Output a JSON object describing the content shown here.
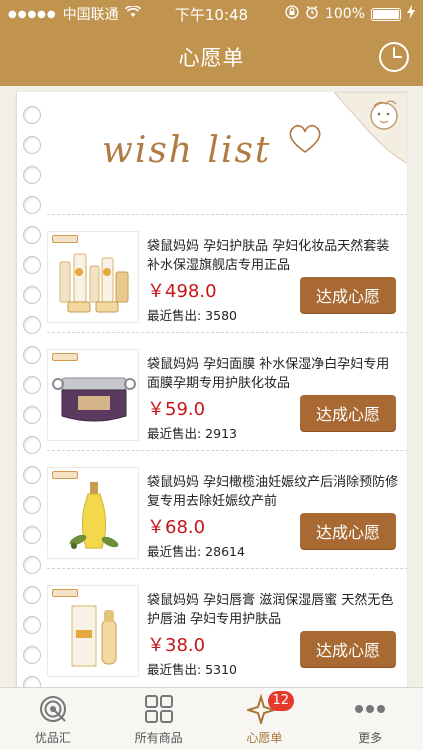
{
  "status_bar": {
    "signal": "●●●●●",
    "carrier": "中国联通",
    "time": "下午10:48",
    "battery": "100%"
  },
  "nav": {
    "title": "心愿单",
    "history_icon": "clock-icon"
  },
  "wishlist": {
    "header_text": "wish list",
    "items": [
      {
        "title": "袋鼠妈妈 孕妇护肤品 孕妇化妆品天然套装补水保湿旗舰店专用正品",
        "price": "￥498.0",
        "sold": "最近售出: 3580",
        "button": "达成心愿"
      },
      {
        "title": "袋鼠妈妈 孕妇面膜 补水保湿净白孕妇专用面膜孕期专用护肤化妆品",
        "price": "￥59.0",
        "sold": "最近售出: 2913",
        "button": "达成心愿"
      },
      {
        "title": "袋鼠妈妈 孕妇橄榄油妊娠纹产后消除预防修复专用去除妊娠纹产前",
        "price": "￥68.0",
        "sold": "最近售出: 28614",
        "button": "达成心愿"
      },
      {
        "title": "袋鼠妈妈 孕妇唇膏 滋润保湿唇蜜 天然无色护唇油 孕妇专用护肤品",
        "price": "￥38.0",
        "sold": "最近售出: 5310",
        "button": "达成心愿"
      }
    ]
  },
  "tabbar": {
    "tabs": [
      {
        "label": "优品汇",
        "icon": "target-icon"
      },
      {
        "label": "所有商品",
        "icon": "grid-icon"
      },
      {
        "label": "心愿单",
        "icon": "sparkle-icon",
        "badge": "12",
        "active": true
      },
      {
        "label": "更多",
        "icon": "more-dots-icon"
      }
    ]
  },
  "colors": {
    "brand": "#c0944f",
    "button": "#a86a32",
    "price": "#c4161c",
    "badge": "#e53a2b"
  }
}
